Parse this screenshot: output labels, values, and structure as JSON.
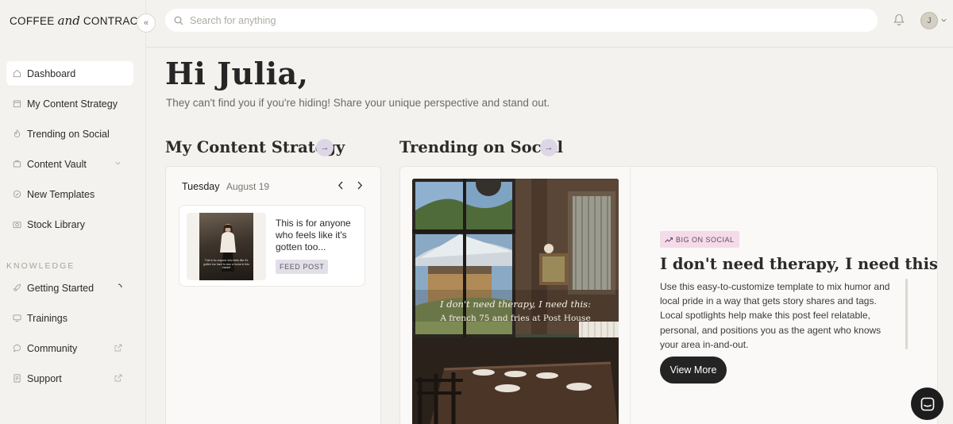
{
  "brand": {
    "prefix": "COFFEE ",
    "and": "and",
    "suffix": " CONTRACTS"
  },
  "collapse_label": "«",
  "nav": {
    "items": [
      {
        "label": "Dashboard",
        "icon": "home-icon"
      },
      {
        "label": "My Content Strategy",
        "icon": "calendar-icon"
      },
      {
        "label": "Trending on Social",
        "icon": "trend-icon"
      },
      {
        "label": "Content Vault",
        "icon": "vault-icon"
      },
      {
        "label": "New Templates",
        "icon": "template-icon"
      },
      {
        "label": "Stock Library",
        "icon": "camera-icon"
      }
    ],
    "section_label": "KNOWLEDGE",
    "knowledge_items": [
      {
        "label": "Getting Started",
        "icon": "rocket-icon"
      },
      {
        "label": "Trainings",
        "icon": "monitor-icon"
      },
      {
        "label": "Community",
        "icon": "chat-icon"
      },
      {
        "label": "Support",
        "icon": "document-icon"
      }
    ]
  },
  "search": {
    "placeholder": "Search for anything",
    "value": ""
  },
  "user": {
    "initial": "J"
  },
  "greeting": {
    "title": "Hi Julia,",
    "subtitle": "They can't find you if you're hiding! Share your unique perspective and stand out."
  },
  "strategy": {
    "title": "My Content Strategy",
    "arrow": "→",
    "day": "Tuesday",
    "date": "August 19",
    "post": {
      "text": "This is for anyone who feels like it's gotten too...",
      "badge": "FEED POST",
      "thumb_caption": "This is for anyone who feels like it's gotten too hard to own a home in this market"
    }
  },
  "trending": {
    "title": "Trending on Social",
    "arrow": "→",
    "image_caption_1": "I don't need therapy, I need this:",
    "image_caption_2": "A french 75 and fries at Post House",
    "tag": "BIG ON SOCIAL",
    "headline": "I don't need therapy, I need this:",
    "description": "Use this easy-to-customize template to mix humor and local pride in a way that gets story shares and tags. Local spotlights help make this post feel relatable, personal, and positions you as the agent who knows your area in-and-out.",
    "cta": "View More"
  },
  "colors": {
    "accent_purple": "#ddd6e6",
    "tag_pink": "#f3dbe9",
    "dark": "#242424",
    "background": "#f4f2ef"
  }
}
